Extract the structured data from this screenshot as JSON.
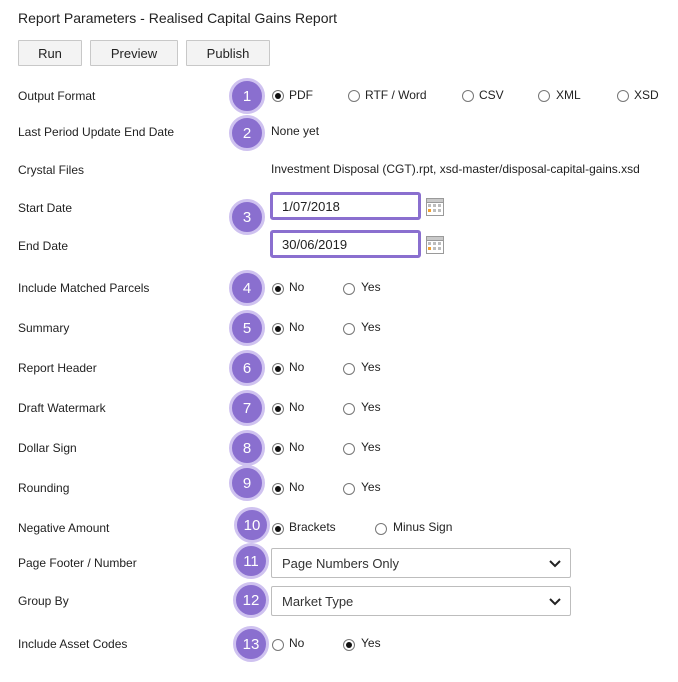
{
  "page_title": "Report Parameters - Realised Capital Gains Report",
  "toolbar": {
    "run": "Run",
    "preview": "Preview",
    "publish": "Publish"
  },
  "badges": [
    "1",
    "2",
    "3",
    "4",
    "5",
    "6",
    "7",
    "8",
    "9",
    "10",
    "11",
    "12",
    "13"
  ],
  "fields": {
    "output_format": {
      "label": "Output Format",
      "options": [
        "PDF",
        "RTF / Word",
        "CSV",
        "XML",
        "XSD"
      ],
      "selected": "PDF"
    },
    "last_period": {
      "label": "Last Period Update End Date",
      "value": "None yet"
    },
    "crystal_files": {
      "label": "Crystal Files",
      "value": "Investment Disposal (CGT).rpt, xsd-master/disposal-capital-gains.xsd"
    },
    "start_date": {
      "label": "Start Date",
      "value": "1/07/2018"
    },
    "end_date": {
      "label": "End Date",
      "value": "30/06/2019"
    },
    "include_matched_parcels": {
      "label": "Include Matched Parcels",
      "options": [
        "No",
        "Yes"
      ],
      "selected": "No"
    },
    "summary": {
      "label": "Summary",
      "options": [
        "No",
        "Yes"
      ],
      "selected": "No"
    },
    "report_header": {
      "label": "Report Header",
      "options": [
        "No",
        "Yes"
      ],
      "selected": "No"
    },
    "draft_watermark": {
      "label": "Draft Watermark",
      "options": [
        "No",
        "Yes"
      ],
      "selected": "No"
    },
    "dollar_sign": {
      "label": "Dollar Sign",
      "options": [
        "No",
        "Yes"
      ],
      "selected": "No"
    },
    "rounding": {
      "label": "Rounding",
      "options": [
        "No",
        "Yes"
      ],
      "selected": "No"
    },
    "negative_amount": {
      "label": "Negative Amount",
      "options": [
        "Brackets",
        "Minus Sign"
      ],
      "selected": "Brackets"
    },
    "page_footer": {
      "label": "Page Footer / Number",
      "value": "Page Numbers Only"
    },
    "group_by": {
      "label": "Group By",
      "value": "Market Type"
    },
    "include_asset_codes": {
      "label": "Include Asset Codes",
      "options": [
        "No",
        "Yes"
      ],
      "selected": "Yes"
    }
  },
  "icons": {
    "calendar": "calendar-icon",
    "dropdown": "chevron-down-icon"
  },
  "colors": {
    "badge": "#8a6fcf",
    "badge_ring": "#cfc2f0",
    "focus_border": "#8a6fcf"
  }
}
